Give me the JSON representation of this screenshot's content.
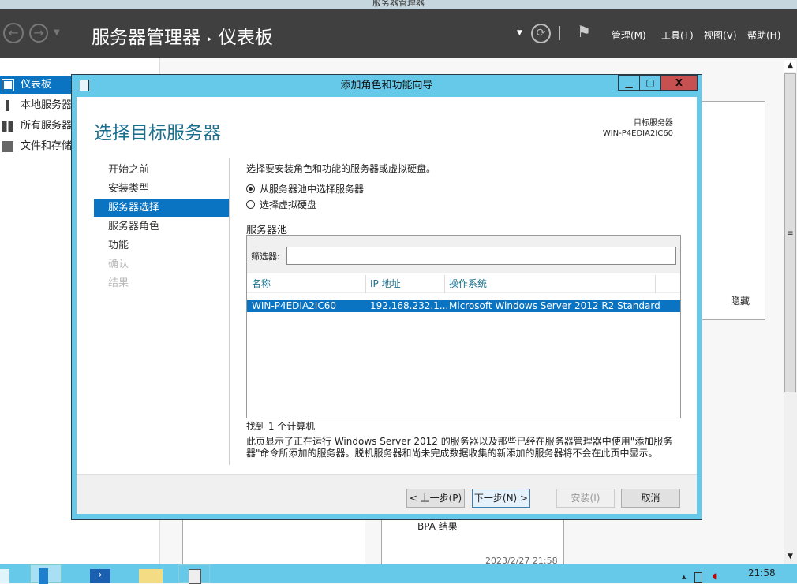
{
  "window": {
    "title": "服务器管理器"
  },
  "header": {
    "title": "服务器管理器",
    "separator": "‣",
    "page": "仪表板",
    "menus": [
      "管理(M)",
      "工具(T)",
      "视图(V)",
      "帮助(H)"
    ]
  },
  "sidebar": {
    "items": [
      {
        "label": "仪表板",
        "icon": "dashboard-icon"
      },
      {
        "label": "本地服务器",
        "icon": "server-icon"
      },
      {
        "label": "所有服务器",
        "icon": "servers-icon"
      },
      {
        "label": "文件和存储",
        "icon": "storage-icon"
      }
    ]
  },
  "background": {
    "hide": "隐藏",
    "bpa": "BPA 结果",
    "timestamp": "2023/2/27 21:58"
  },
  "dialog": {
    "title": "添加角色和功能向导",
    "heading": "选择目标服务器",
    "target_label": "目标服务器",
    "target_value": "WIN-P4EDIA2IC60",
    "steps": [
      {
        "label": "开始之前",
        "state": "done"
      },
      {
        "label": "安装类型",
        "state": "done"
      },
      {
        "label": "服务器选择",
        "state": "active"
      },
      {
        "label": "服务器角色",
        "state": "done"
      },
      {
        "label": "功能",
        "state": "done"
      },
      {
        "label": "确认",
        "state": "disabled"
      },
      {
        "label": "结果",
        "state": "disabled"
      }
    ],
    "intro": "选择要安装角色和功能的服务器或虚拟硬盘。",
    "radio_pool": "从服务器池中选择服务器",
    "radio_vhd": "选择虚拟硬盘",
    "selected_radio": "pool",
    "pool_label": "服务器池",
    "filter_label": "筛选器:",
    "filter_value": "",
    "columns": [
      "名称",
      "IP 地址",
      "操作系统"
    ],
    "rows": [
      {
        "name": "WIN-P4EDIA2IC60",
        "ip": "192.168.232.1...",
        "os": "Microsoft Windows Server 2012 R2 Standard",
        "selected": true
      }
    ],
    "found": "找到 1 个计算机",
    "note": "此页显示了正在运行 Windows Server 2012 的服务器以及那些已经在服务器管理器中使用\"添加服务器\"命令所添加的服务器。脱机服务器和尚未完成数据收集的新添加的服务器将不会在此页中显示。",
    "buttons": {
      "prev": "< 上一步(P)",
      "next": "下一步(N) >",
      "install": "安装(I)",
      "cancel": "取消"
    }
  },
  "taskbar": {
    "time": "21:58"
  },
  "colors": {
    "accent": "#0b74c2",
    "dialog_frame": "#66c9ea",
    "header": "#404040",
    "close": "#c75050"
  }
}
